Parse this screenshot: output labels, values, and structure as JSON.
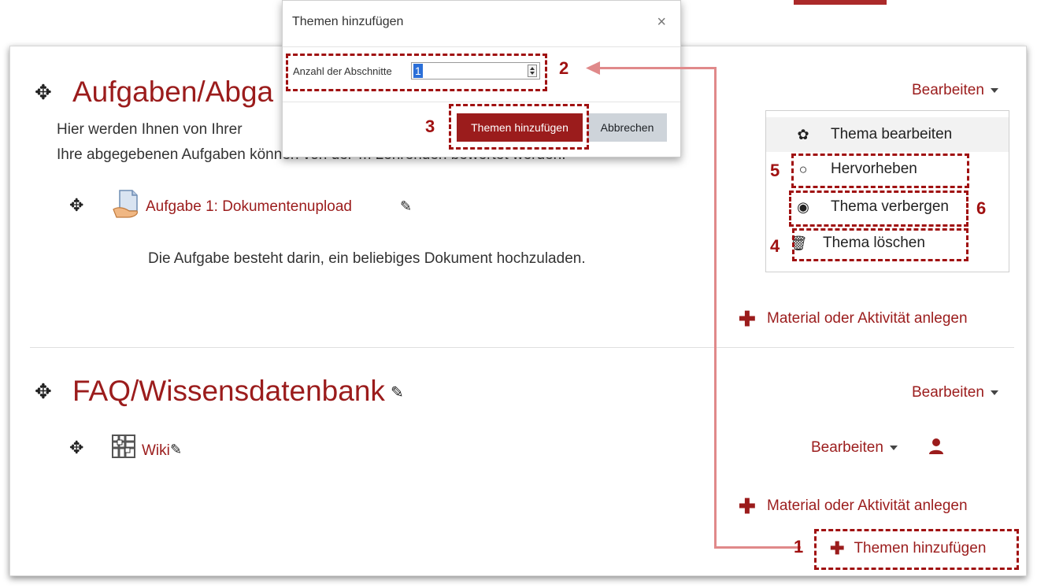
{
  "modal": {
    "title": "Themen hinzufügen",
    "close": "×",
    "field_label": "Anzahl der Abschnitte",
    "field_value": "1",
    "primary_button": "Themen hinzufügen",
    "secondary_button": "Abbrechen"
  },
  "section1": {
    "title": "Aufgaben/Abga",
    "line1": "Hier werden Ihnen von Ihrer",
    "line2": "Ihre abgegebenen Aufgaben können von der*m Lehrenden bewertet werden.",
    "activity_label": "Aufgabe 1: Dokumentenupload",
    "activity_description": "Die Aufgabe besteht darin, ein beliebiges Dokument hochzuladen.",
    "edit_label": "Bearbeiten",
    "add_material": "Material oder Aktivität anlegen"
  },
  "menu": {
    "items": [
      {
        "label": "Thema bearbeiten",
        "icon": "gear-icon"
      },
      {
        "label": "Hervorheben",
        "icon": "circle-icon"
      },
      {
        "label": "Thema verbergen",
        "icon": "eye-icon"
      },
      {
        "label": "Thema löschen",
        "icon": "trash-icon"
      }
    ]
  },
  "section2": {
    "title": "FAQ/Wissensdatenbank",
    "edit_label": "Bearbeiten",
    "wiki_label": "Wiki",
    "wiki_edit_label": "Bearbeiten",
    "add_material": "Material oder Aktivität anlegen",
    "add_topics": "Themen hinzufügen"
  },
  "annotations": {
    "n1": "1",
    "n2": "2",
    "n3": "3",
    "n4": "4",
    "n5": "5",
    "n6": "6"
  },
  "colors": {
    "accent": "#9b1c1c",
    "annotation": "#a01111",
    "connector": "#e0898a"
  }
}
